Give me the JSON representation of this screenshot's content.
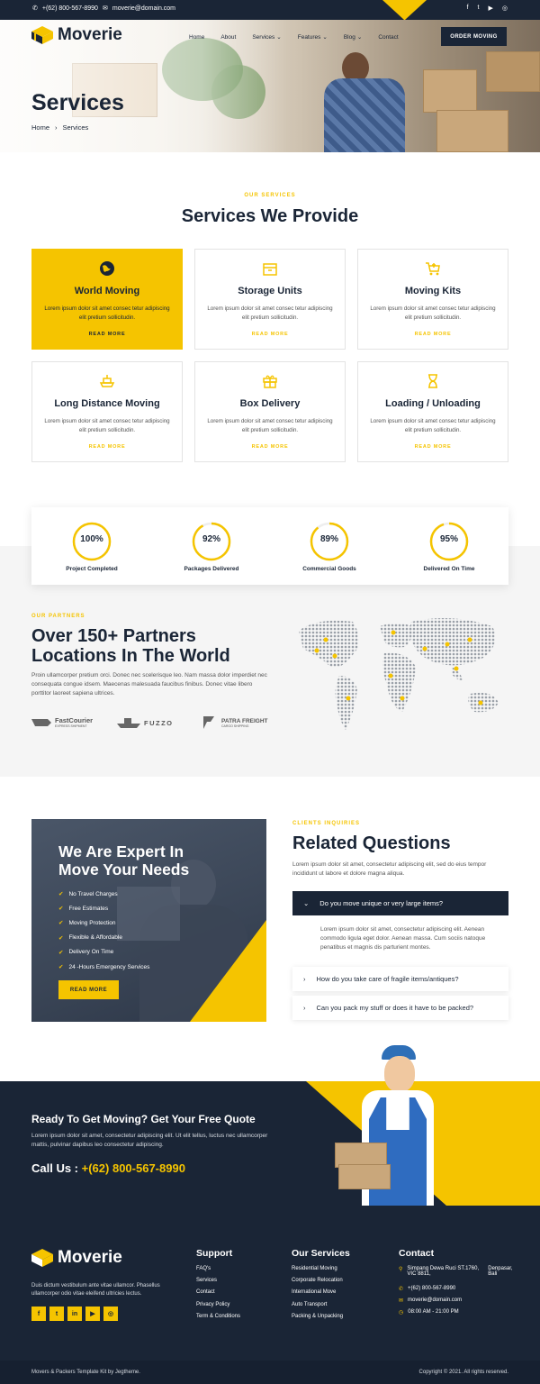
{
  "topbar": {
    "phone": "+(62) 800-567-8990",
    "email": "moverie@domain.com",
    "social": [
      "f",
      "t",
      "yt",
      "ig"
    ]
  },
  "brand": {
    "name": "Moverie"
  },
  "nav": {
    "items": [
      "Home",
      "About",
      "Services",
      "Features",
      "Blog",
      "Contact"
    ],
    "cta": "ORDER MOVING"
  },
  "hero": {
    "title": "Services",
    "breadcrumb_home": "Home",
    "breadcrumb_current": "Services"
  },
  "services": {
    "eyebrow": "OUR SERVICES",
    "title": "Services We Provide",
    "items": [
      {
        "title": "World Moving",
        "desc": "Lorem ipsum dolor sit amet consec tetur adipiscing elit pretium sollicitudin.",
        "link": "READ MORE",
        "icon": "globe-icon"
      },
      {
        "title": "Storage Units",
        "desc": "Lorem ipsum dolor sit amet consec tetur adipiscing elit pretium sollicitudin.",
        "link": "READ MORE",
        "icon": "box-icon"
      },
      {
        "title": "Moving Kits",
        "desc": "Lorem ipsum dolor sit amet consec tetur adipiscing elit pretium sollicitudin.",
        "link": "READ MORE",
        "icon": "cart-icon"
      },
      {
        "title": "Long Distance Moving",
        "desc": "Lorem ipsum dolor sit amet consec tetur adipiscing elit pretium sollicitudin.",
        "link": "READ MORE",
        "icon": "ship-icon"
      },
      {
        "title": "Box Delivery",
        "desc": "Lorem ipsum dolor sit amet consec tetur adipiscing elit pretium sollicitudin.",
        "link": "READ MORE",
        "icon": "gift-icon"
      },
      {
        "title": "Loading / Unloading",
        "desc": "Lorem ipsum dolor sit amet consec tetur adipiscing elit pretium sollicitudin.",
        "link": "READ MORE",
        "icon": "hourglass-icon"
      }
    ]
  },
  "stats": [
    {
      "value": "100%",
      "label": "Project Completed",
      "fraction": 1.0
    },
    {
      "value": "92%",
      "label": "Packages Delivered",
      "fraction": 0.92
    },
    {
      "value": "89%",
      "label": "Commercial Goods",
      "fraction": 0.89
    },
    {
      "value": "95%",
      "label": "Delivered On Time",
      "fraction": 0.95
    }
  ],
  "partners": {
    "eyebrow": "OUR PARTNERS",
    "title_line1": "Over 150+ Partners",
    "title_line2": "Locations In The World",
    "text": "Proin ullamcorper pretium orci. Donec nec scelerisque leo. Nam massa dolor imperdiet nec consequata congue idsem. Maecenas malesuada faucibus finibus. Donec vitae libero porttitor laoreet sapiena ultrices.",
    "logos": [
      {
        "name": "FastCourier",
        "sub": "EXPRESS SHIPMENT"
      },
      {
        "name": "FUZZO",
        "sub": ""
      },
      {
        "name": "PATRA FREIGHT",
        "sub": "CARGO SHIPPING"
      }
    ]
  },
  "expert": {
    "title_line1": "We Are Expert In",
    "title_line2": "Move Your Needs",
    "items": [
      "No Travel Charges",
      "Free Estimates",
      "Moving Protection",
      "Flexible & Affordable",
      "Delivery On Time",
      "24 -Hours Emergency Services"
    ],
    "button": "READ MORE"
  },
  "faq": {
    "eyebrow": "CLIENTS INQUIRIES",
    "title": "Related Questions",
    "intro": "Lorem ipsum dolor sit amet, consectetur adipiscing elit, sed do eius tempor incididunt ut labore et dolore magna aliqua.",
    "open_question": "Do you move unique or very large items?",
    "open_answer": "Lorem ipsum dolor sit amet, consectetur adipiscing elit. Aenean commodo ligula eget dolor. Aenean massa. Cum sociis natoque penatibus et magnis dis parturient montes.",
    "q2": "How do you take care of fragile items/antiques?",
    "q3": "Can you pack my stuff or does it have to be packed?"
  },
  "cta": {
    "title": "Ready To Get Moving? Get Your Free Quote",
    "text": "Lorem ipsum dolor sit amet, consectetur adipiscing elit. Ut elit tellus, luctus nec ullamcorper mattis, pulvinar dapibus leo consectetur adipiscing.",
    "call_label": "Call Us :",
    "call_number": "+(62) 800-567-8990"
  },
  "footer": {
    "about": "Duis dictum vestibulum ante vitae ullamcor. Phasellus ullamcorper odio vitae eleifend ultricies lectus.",
    "support_title": "Support",
    "support": [
      "FAQ's",
      "Services",
      "Contact",
      "Privacy Policy",
      "Term & Conditions"
    ],
    "services_title": "Our Services",
    "services": [
      "Residential Moving",
      "Corporate Relocation",
      "International Move",
      "Auto Transport",
      "Packing & Unpacking"
    ],
    "contact_title": "Contact",
    "address_line1": "Simpang Dewa Ruci ST.1760, VIC 8811,",
    "address_line2": "Denpasar, Bali",
    "phone": "+(62) 800-567-8990",
    "email": "moverie@domain.com",
    "hours": "08:00 AM - 21:00 PM",
    "social": [
      "f",
      "t",
      "in",
      "yt",
      "ig"
    ],
    "credit": "Movers & Packers Template Kit by Jegtheme.",
    "copyright": "Copyright © 2021. All rights reserved."
  },
  "colors": {
    "accent": "#f5c400",
    "navy": "#1a2536",
    "gray_band": "#f5f5f5"
  }
}
